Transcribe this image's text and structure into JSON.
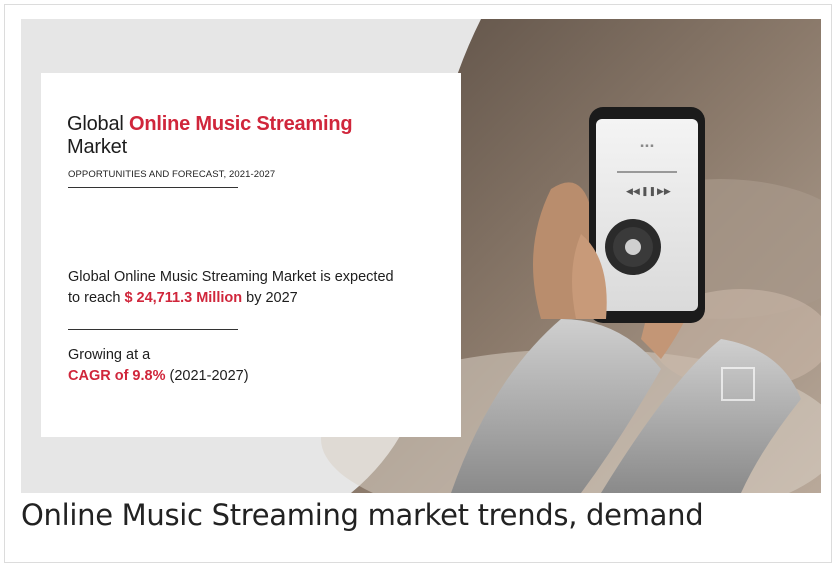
{
  "banner": {
    "title_prefix": "Global",
    "title_highlight": "Online Music Streaming",
    "title_suffix": "Market",
    "subtitle": "OPPORTUNITIES AND FORECAST, 2021-2027",
    "stat_text_before": "Global Online Music Streaming Market is expected to reach",
    "stat_value": "$ 24,711.3 Million",
    "stat_text_after": "by 2027",
    "growth_prefix": "Growing at a",
    "growth_value": "CAGR of 9.8%",
    "growth_period": "(2021-2027)"
  },
  "colors": {
    "accent_red": "#d0263b",
    "background_gray": "#e6e6e6"
  },
  "caption": "Online Music Streaming market trends, demand"
}
